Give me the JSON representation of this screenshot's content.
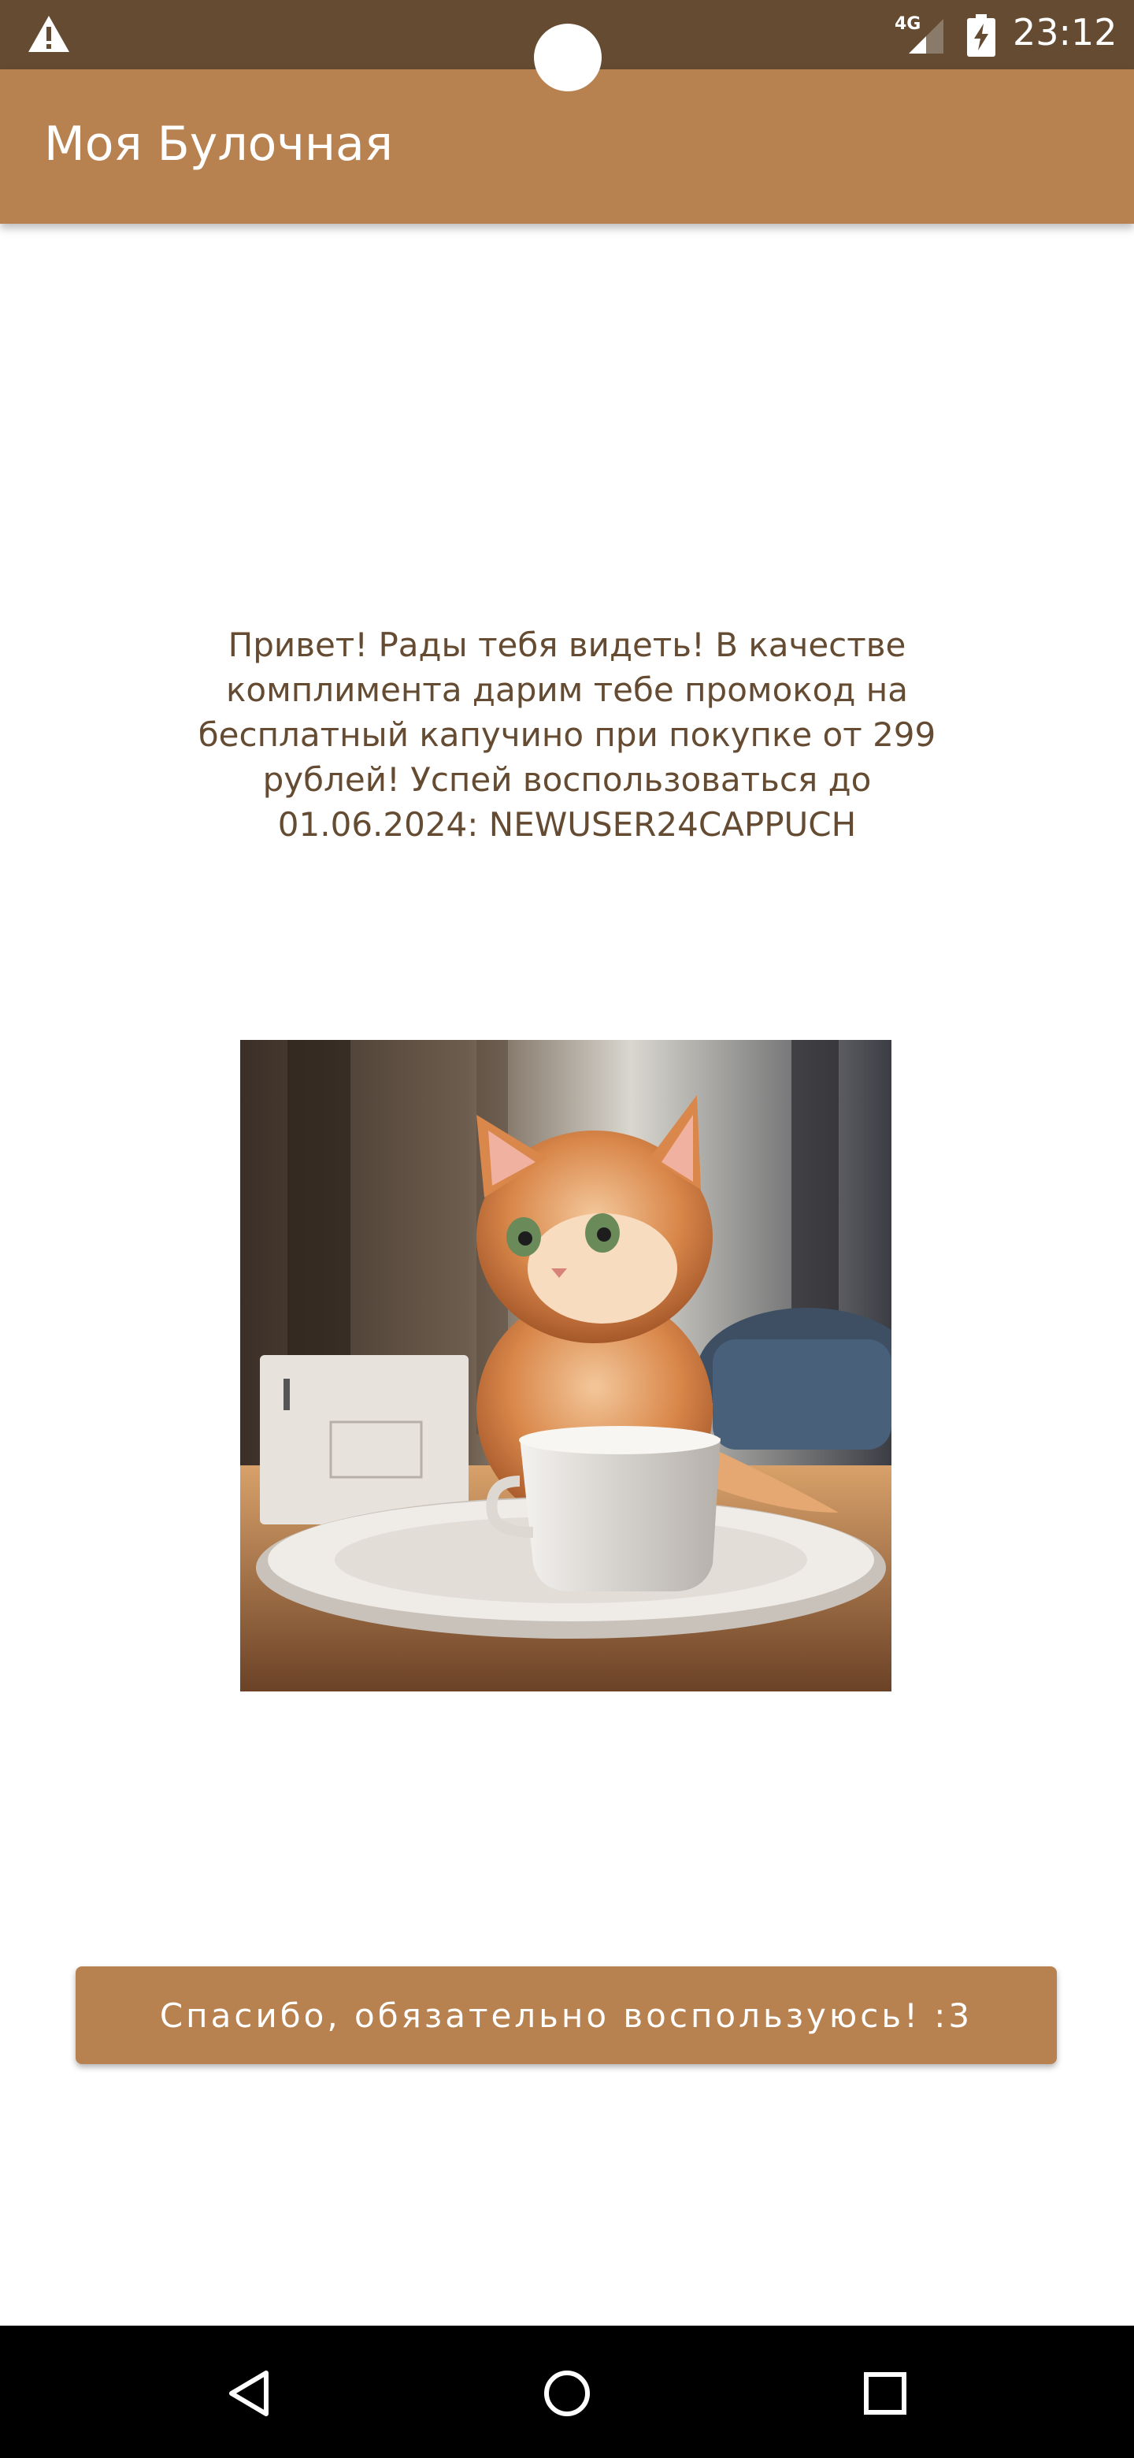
{
  "status_bar": {
    "network_type": "4G",
    "time": "23:12",
    "icons": [
      "warning-icon",
      "signal-icon",
      "battery-charging-icon"
    ]
  },
  "app_bar": {
    "title": "Моя Булочная"
  },
  "main": {
    "promo_text": "Привет! Рады тебя видеть! В качестве комплимента дарим тебе промокод на бесплатный капучино при покупке от 299 рублей! Успей воспользоваться до 01.06.2024: NEWUSER24CAPPUCH",
    "picture_description_icon": "kitten-with-coffee-cup-image"
  },
  "confirm_button": {
    "label": "Спасибо, обязательно воспользуюсь! :3"
  },
  "nav_bar": {
    "icons": [
      "back-icon",
      "home-icon",
      "recents-icon"
    ]
  },
  "colors": {
    "status_bar": "#644b32",
    "app_bar": "#b88150",
    "button": "#b88150",
    "text_brown": "#644b32",
    "nav_bar": "#000000"
  }
}
